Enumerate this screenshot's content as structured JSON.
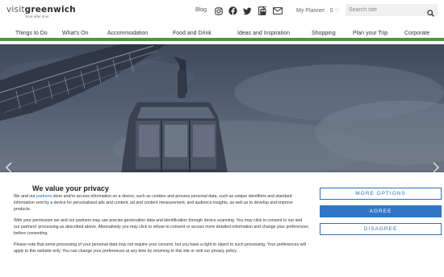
{
  "header": {
    "logo_main_a": "visit",
    "logo_main_b": "greenwich",
    "logo_tag": "time after time",
    "blog_label": "Blog",
    "planner_label": "My Planner",
    "planner_count": "0",
    "search_placeholder": "Search site"
  },
  "social_icons": [
    "instagram-icon",
    "facebook-icon",
    "twitter-icon",
    "document-icon",
    "cable-car-icon",
    "mail-icon"
  ],
  "nav": {
    "items": [
      "Things to Do",
      "What's On",
      "Accommodation",
      "Food and Drink",
      "Ideas and Inspiration",
      "Shopping",
      "Plan your Trip",
      "Corporate"
    ]
  },
  "hero": {
    "prev_icon": "chevron-left-icon",
    "next_icon": "chevron-right-icon"
  },
  "consent": {
    "title": "We value your privacy",
    "p1_a": "We and our ",
    "p1_link": "partners",
    "p1_b": " store and/or access information on a device, such as cookies and process personal data, such as unique identifiers and standard information sent by a device for personalised ads and content, ad and content measurement, and audience insights, as well as to develop and improve products.",
    "p2": "With your permission we and our partners may use precise geolocation data and identification through device scanning. You may click to consent to our and our partners' processing as described above. Alternatively you may click to refuse to consent or access more detailed information and change your preferences before consenting.",
    "p3": "Please note that some processing of your personal data may not require your consent, but you have a right to object to such processing. Your preferences will apply to this website only. You can change your preferences at any time by returning to this site or visit our privacy policy.",
    "more_options": "MORE OPTIONS",
    "agree": "AGREE",
    "disagree": "DISAGREE"
  },
  "colors": {
    "accent_green": "#4a9a3a",
    "button_blue": "#2f76c8",
    "link_blue": "#1a73c9"
  }
}
